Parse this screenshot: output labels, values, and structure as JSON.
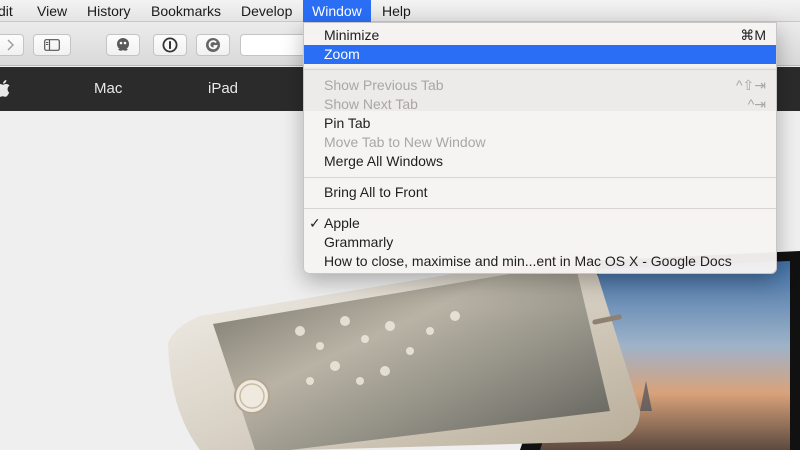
{
  "menubar": {
    "items": [
      "dit",
      "View",
      "History",
      "Bookmarks",
      "Develop",
      "Window",
      "Help"
    ]
  },
  "site_nav": {
    "links": [
      "Mac",
      "iPad"
    ]
  },
  "window_menu": {
    "items": [
      {
        "label": "Minimize",
        "shortcut": "⌘M",
        "enabled": true
      },
      {
        "label": "Zoom",
        "shortcut": "",
        "enabled": true,
        "highlighted": true
      },
      {
        "label": "Show Previous Tab",
        "shortcut": "^⇧⇥",
        "enabled": false
      },
      {
        "label": "Show Next Tab",
        "shortcut": "^⇥",
        "enabled": false
      },
      {
        "label": "Pin Tab",
        "shortcut": "",
        "enabled": true
      },
      {
        "label": "Move Tab to New Window",
        "shortcut": "",
        "enabled": false
      },
      {
        "label": "Merge All Windows",
        "shortcut": "",
        "enabled": true
      },
      {
        "label": "Bring All to Front",
        "shortcut": "",
        "enabled": true
      },
      {
        "label": "Apple",
        "shortcut": "",
        "enabled": true,
        "checked": true,
        "check_mark": "✓"
      },
      {
        "label": "Grammarly",
        "shortcut": "",
        "enabled": true
      },
      {
        "label": "How to close, maximise and min...ent in Mac OS X - Google Docs",
        "shortcut": "",
        "enabled": true
      }
    ]
  },
  "icons": {
    "forward": "chevron-right-icon",
    "sidebar": "sidebar-icon",
    "extension1": "octopus-extension-icon",
    "extension2": "1password-icon",
    "extension3": "grammarly-icon",
    "apple": "apple-logo-icon"
  },
  "colors": {
    "menu_highlight": "#2a6ef6",
    "site_nav_bg": "#2b2b2b",
    "disabled_text": "#a9a6a7"
  }
}
